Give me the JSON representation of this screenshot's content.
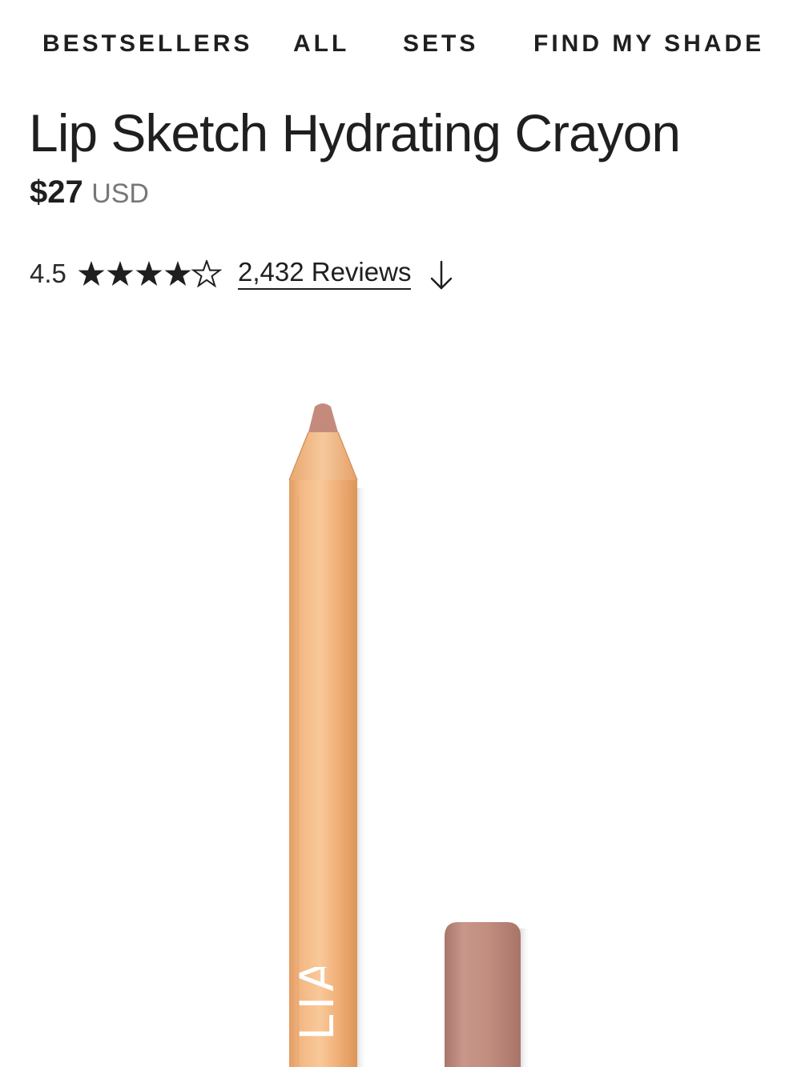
{
  "nav": {
    "items": [
      "BESTSELLERS",
      "ALL",
      "SETS",
      "FIND MY SHADE"
    ]
  },
  "product": {
    "title": "Lip Sketch Hydrating Crayon",
    "price": {
      "amount": "$27",
      "currency": "USD"
    },
    "rating": {
      "value": "4.5",
      "max": 5,
      "stars_filled": 4.5
    },
    "reviews": {
      "label": "2,432 Reviews"
    },
    "image": {
      "logo_text": "LIA",
      "pencil_color": "#f0b380",
      "tip_color": "#c48b7d",
      "cap_color": "#c08c7e"
    }
  },
  "icons": {
    "rating": "star-icon",
    "scroll": "arrow-down-icon"
  },
  "colors": {
    "text": "#1f1f1f",
    "muted": "#777777",
    "background": "#ffffff"
  }
}
